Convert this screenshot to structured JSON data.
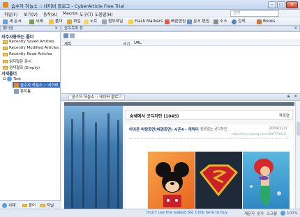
{
  "window": {
    "title": "숨수자 하늘소 :: 네이버 블로그 - CyberArticle Free Trial",
    "min": "–",
    "max": "□",
    "close": "✕"
  },
  "menubar": {
    "items": [
      "파일(F)",
      "보기(V)",
      "동작(A)",
      "Macros",
      "도구(T)",
      "도움말(H)"
    ],
    "search_placeholder": "검색"
  },
  "toolbar": {
    "items": [
      "새 문서",
      "서재",
      "폴더",
      "파일",
      "노트",
      "첨부파일",
      "Flash Markers",
      "빠른편집",
      "문서 편집",
      "소스",
      "검색",
      "Books"
    ]
  },
  "sidebar": {
    "header": "폴더형",
    "fav_title": "자주사용하는 폴더",
    "fav_items": [
      "Recently Saved Articles",
      "Recently Modified Articles",
      "Recently Read Articles",
      "읽지않은 문서",
      "검색결과 (Empty)"
    ],
    "folder_title": "서재폴더",
    "tree": {
      "root": "Test",
      "selected": "숨수자 하늘소 :: 네이버",
      "child2": "휴지통"
    },
    "tabs": [
      "서재",
      "폴더",
      "저널"
    ]
  },
  "list": {
    "header": "항목목록 창",
    "columns": [
      "제목",
      "크기",
      "URL"
    ]
  },
  "detail": {
    "tab_title": "숨수자 하늘소 :: 네이버 블로그",
    "blog_title": "숨쉐에서 굿디자인 (1045)",
    "blog_right": "목록열",
    "post_title": "아이콘 바탕화면(배경화면) 시즌4 - 캐릭터",
    "post_category": "분류없는 굿디자인",
    "post_date": "2009/12/1",
    "post_url": "http://heavysblog.com/300774010"
  },
  "status": {
    "warning": "Don't use the leaked SN. Click here to buy",
    "a": "재문자",
    "b": "숫자",
    "c": "스크롤",
    "zoom": "100%"
  },
  "colors": {
    "accent": "#1b5fc0",
    "sidebar_bg": "#ffffff",
    "chrome": "#dfe6f0"
  }
}
